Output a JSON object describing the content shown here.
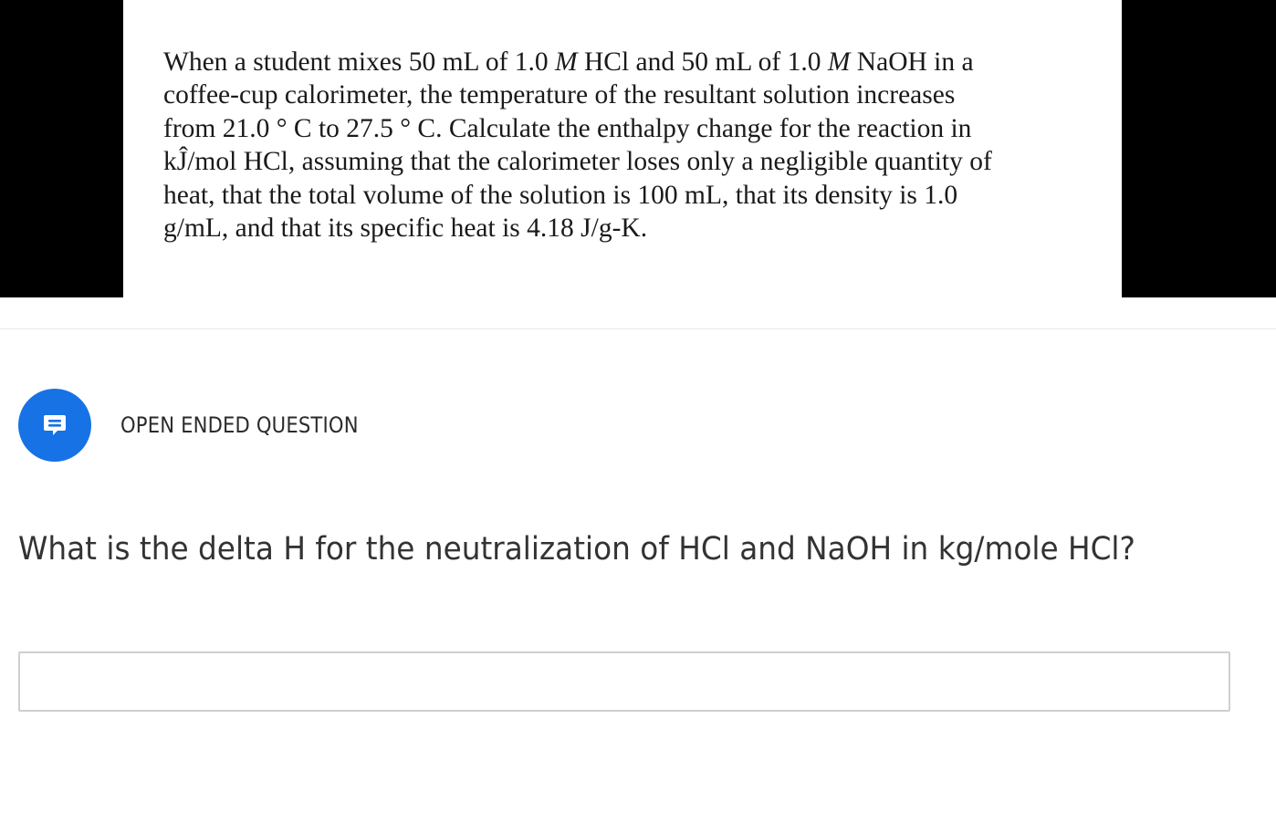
{
  "problem_image": {
    "lines": [
      "When a student mixes 50 mL of 1.0 ",
      "M",
      " HCl and 50 mL of 1.0 ",
      "M",
      " NaOH in a",
      "coffee-cup calorimeter, the temperature of the resultant solution increases",
      "from 21.0 ° C to 27.5 ° C. Calculate the enthalpy change for the reaction in",
      "kĴ/mol HCl, assuming that the calorimeter loses only a negligible quantity of",
      "heat, that the total volume of the solution is 100 mL, that its density is 1.0",
      "g/mL, and that its specific heat is 4.18 J/g-K."
    ]
  },
  "question": {
    "type_icon": "chat-bubble-icon",
    "type_label": "OPEN ENDED QUESTION",
    "text": "What is the delta H for the neutralization of HCl and NaOH in kg/mole HCl?",
    "icon_color": "#1672e5"
  },
  "answer": {
    "value": "",
    "placeholder": ""
  }
}
